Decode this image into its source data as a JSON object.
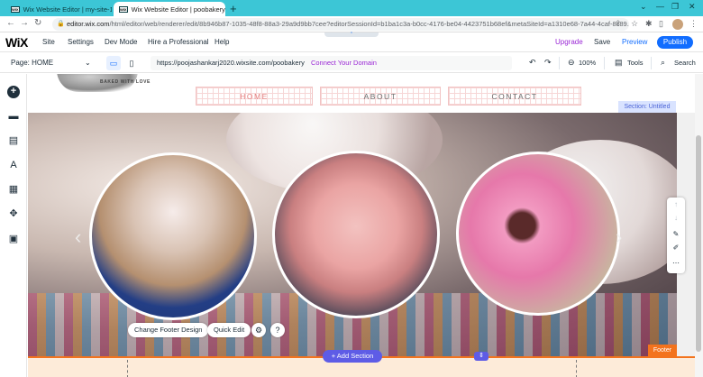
{
  "browser": {
    "tabs": [
      {
        "label": "Wix Website Editor | my-site-1"
      },
      {
        "label": "Wix Website Editor | poobakery"
      }
    ],
    "url_host": "editor.wix.com",
    "url_rest": "/html/editor/web/renderer/edit/8b946b87-1035-48f8-88a3-29a9d9bb7cee?editorSessionId=b1ba1c3a-b0cc-4176-be04-4423751b68ef&metaSiteId=a1310e68-7a44-4caf-8c89..."
  },
  "wix_topbar": {
    "logo": "WiX",
    "menu": [
      "Site",
      "Settings",
      "Dev Mode",
      "Hire a Professional",
      "Help"
    ],
    "upgrade": "Upgrade",
    "save": "Save",
    "preview": "Preview",
    "publish": "Publish"
  },
  "secondary_bar": {
    "page": "Page: HOME",
    "site_url": "https://poojashankarj2020.wixsite.com/poobakery",
    "connect_domain": "Connect Your Domain",
    "zoom": "100%",
    "tools": "Tools",
    "search": "Search"
  },
  "site": {
    "logo_text": "BAKED WITH LOVE",
    "nav": [
      "HOME",
      "ABOUT",
      "CONTACT"
    ],
    "section_label": "Section: Untitled",
    "footer_label": "Footer",
    "change_footer_design": "Change Footer Design",
    "quick_edit": "Quick Edit",
    "add_section": "+ Add Section"
  },
  "colors": {
    "accent": "#116dff",
    "upgrade": "#9a27d5",
    "footer": "#f3731d",
    "add_section": "#5e5ce6"
  }
}
